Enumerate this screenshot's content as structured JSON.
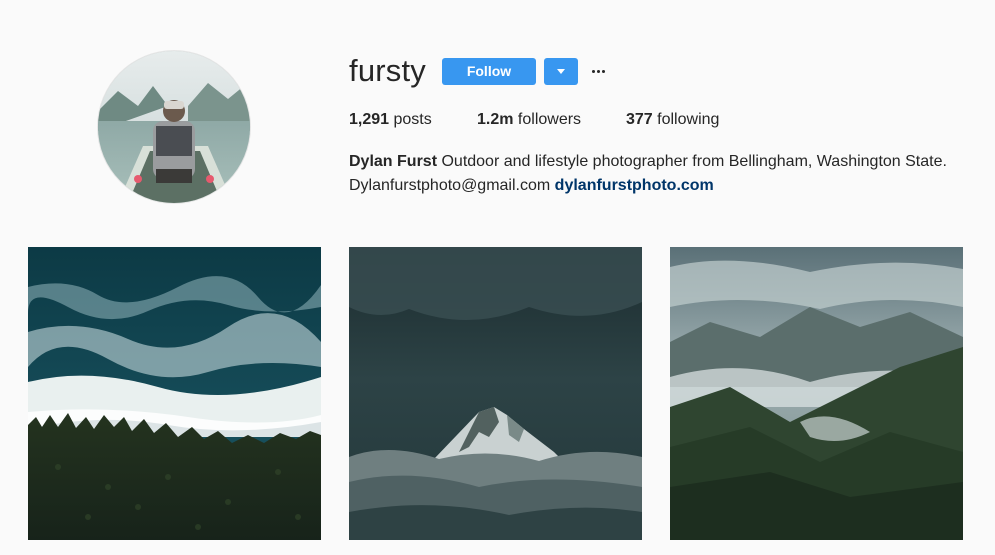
{
  "profile": {
    "username": "fursty",
    "follow_label": "Follow",
    "display_name": "Dylan Furst",
    "bio_text": "Outdoor and lifestyle photographer from Bellingham, Washington State. Dylanfurstphoto@gmail.com",
    "website": "dylanfurstphoto.com"
  },
  "stats": {
    "posts_count": "1,291",
    "posts_label": "posts",
    "followers_count": "1.2m",
    "followers_label": "followers",
    "following_count": "377",
    "following_label": "following"
  },
  "icons": {
    "dropdown": "chevron-down-icon",
    "more": "more-options-icon"
  },
  "colors": {
    "accent": "#3897f0",
    "link": "#003569",
    "text": "#262626",
    "background": "#fafafa"
  }
}
